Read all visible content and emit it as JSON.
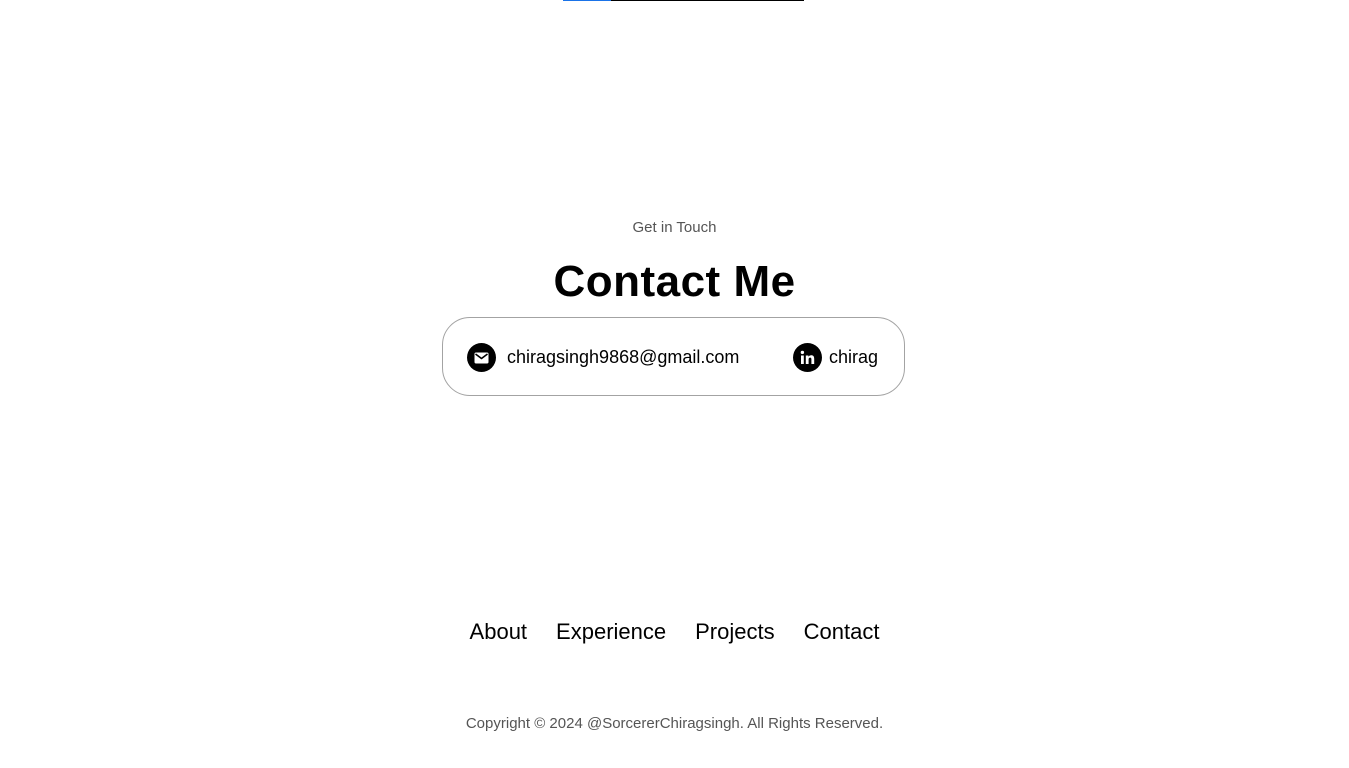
{
  "scroll_progress": {
    "fraction": 0.2,
    "fill_color": "#1a73e8",
    "track_color": "#000000"
  },
  "contact": {
    "subtitle": "Get in Touch",
    "title": "Contact Me",
    "email": {
      "icon": "mail-icon",
      "text": "chiragsingh9868@gmail.com"
    },
    "linkedin": {
      "icon": "linkedin-icon",
      "text": "chirag"
    }
  },
  "footer": {
    "nav": [
      {
        "label": "About"
      },
      {
        "label": "Experience"
      },
      {
        "label": "Projects"
      },
      {
        "label": "Contact"
      }
    ],
    "copyright": "Copyright © 2024 @SorcererChiragsingh. All Rights Reserved."
  }
}
